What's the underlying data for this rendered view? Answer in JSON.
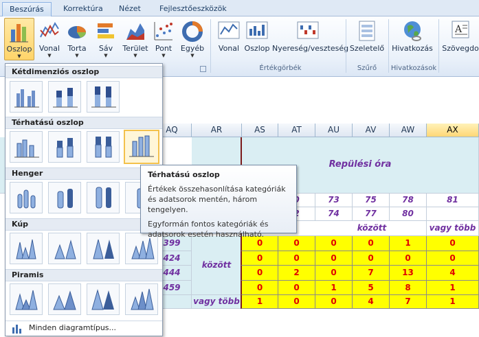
{
  "tabs": [
    "Beszúrás",
    "Korrektúra",
    "Nézet",
    "Fejlesztőeszközök"
  ],
  "ribbon": {
    "charts": [
      {
        "label": "Oszlop",
        "icon": "column-chart-icon"
      },
      {
        "label": "Vonal",
        "icon": "line-chart-icon"
      },
      {
        "label": "Torta",
        "icon": "pie-chart-icon"
      },
      {
        "label": "Sáv",
        "icon": "bar-chart-icon"
      },
      {
        "label": "Terület",
        "icon": "area-chart-icon"
      },
      {
        "label": "Pont",
        "icon": "scatter-chart-icon"
      },
      {
        "label": "Egyéb",
        "icon": "other-charts-icon"
      }
    ],
    "sparklines": [
      {
        "label": "Vonal",
        "icon": "sparkline-line-icon"
      },
      {
        "label": "Oszlop",
        "icon": "sparkline-column-icon"
      },
      {
        "label": "Nyereség/veszteség",
        "icon": "sparkline-winloss-icon"
      }
    ],
    "sparkline_group": "Értékgörbék",
    "slicer": {
      "label": "Szeletelő",
      "icon": "slicer-icon"
    },
    "slicer_group": "Szűrő",
    "hyperlink": {
      "label": "Hivatkozás",
      "icon": "hyperlink-globe-icon"
    },
    "hyperlink_group": "Hivatkozások",
    "textbox": {
      "label": "Szövegdo",
      "icon": "textbox-icon"
    }
  },
  "dropdown": {
    "sections": [
      "Kétdimenziós oszlop",
      "Térhatású oszlop",
      "Henger",
      "Kúp",
      "Piramis"
    ],
    "all_types": "Minden diagramtípus..."
  },
  "tooltip": {
    "title": "Térhatású oszlop",
    "line1": "Értékek összehasonlítása kategóriák és adatsorok mentén, három tengelyen.",
    "line2": "Egyformán fontos kategóriák és adatsorok esetén használható."
  },
  "sheet": {
    "columns": [
      "AQ",
      "AR",
      "AS",
      "AT",
      "AU",
      "AV",
      "AW",
      "AX"
    ],
    "header_title": "Repülési óra",
    "row1": [
      "0",
      "73",
      "75",
      "78",
      "81"
    ],
    "row2": [
      "2",
      "74",
      "77",
      "80",
      ""
    ],
    "between_top": "között",
    "or_more_top": "vagy több",
    "left_values": [
      "399",
      "424",
      "444",
      "459"
    ],
    "between_side": "között",
    "or_more_side": "vagy több",
    "grid": [
      [
        "0",
        "0",
        "0",
        "0",
        "1",
        "0"
      ],
      [
        "0",
        "0",
        "0",
        "0",
        "0",
        "0"
      ],
      [
        "0",
        "2",
        "0",
        "7",
        "13",
        "4"
      ],
      [
        "0",
        "0",
        "1",
        "5",
        "8",
        "1"
      ],
      [
        "1",
        "0",
        "0",
        "4",
        "7",
        "1"
      ]
    ]
  }
}
